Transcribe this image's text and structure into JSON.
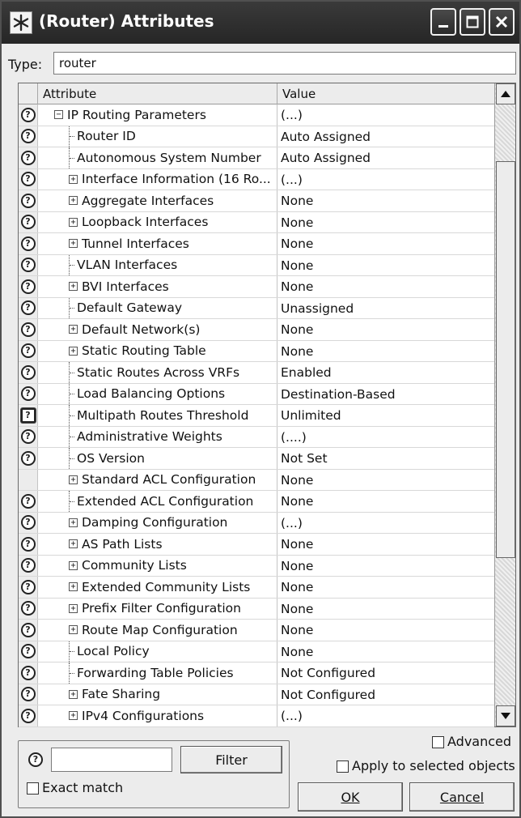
{
  "window": {
    "title": "(Router) Attributes",
    "icon": "asterisk-app-icon",
    "controls": [
      "minimize-icon",
      "maximize-icon",
      "close-icon"
    ]
  },
  "type_row": {
    "label": "Type:",
    "value": "router"
  },
  "table": {
    "headers": {
      "attribute": "Attribute",
      "value": "Value"
    },
    "rows": [
      {
        "attribute": "IP Routing Parameters",
        "value": "(...)",
        "node": "collapse",
        "level": 1,
        "icon": true
      },
      {
        "attribute": "Router ID",
        "value": "Auto Assigned",
        "node": "leaf",
        "level": 2,
        "icon": true
      },
      {
        "attribute": "Autonomous System Number",
        "value": "Auto Assigned",
        "node": "leaf",
        "level": 2,
        "icon": true
      },
      {
        "attribute": "Interface Information (16 Ro...",
        "value": "(...)",
        "node": "expand",
        "level": 2,
        "icon": true
      },
      {
        "attribute": "Aggregate Interfaces",
        "value": "None",
        "node": "expand",
        "level": 2,
        "icon": true
      },
      {
        "attribute": "Loopback Interfaces",
        "value": "None",
        "node": "expand",
        "level": 2,
        "icon": true
      },
      {
        "attribute": "Tunnel Interfaces",
        "value": "None",
        "node": "expand",
        "level": 2,
        "icon": true
      },
      {
        "attribute": "VLAN Interfaces",
        "value": "None",
        "node": "leaf",
        "level": 2,
        "icon": true
      },
      {
        "attribute": "BVI Interfaces",
        "value": "None",
        "node": "expand",
        "level": 2,
        "icon": true
      },
      {
        "attribute": "Default Gateway",
        "value": "Unassigned",
        "node": "leaf",
        "level": 2,
        "icon": true
      },
      {
        "attribute": "Default Network(s)",
        "value": "None",
        "node": "expand",
        "level": 2,
        "icon": true
      },
      {
        "attribute": "Static Routing Table",
        "value": "None",
        "node": "expand",
        "level": 2,
        "icon": true
      },
      {
        "attribute": "Static Routes Across VRFs",
        "value": "Enabled",
        "node": "leaf",
        "level": 2,
        "icon": true
      },
      {
        "attribute": "Load Balancing Options",
        "value": "Destination-Based",
        "node": "leaf",
        "level": 2,
        "icon": true
      },
      {
        "attribute": "Multipath Routes Threshold",
        "value": "Unlimited",
        "node": "leaf",
        "level": 2,
        "icon": true,
        "selected": true
      },
      {
        "attribute": "Administrative Weights",
        "value": "(....)",
        "node": "leaf",
        "level": 2,
        "icon": true
      },
      {
        "attribute": "OS Version",
        "value": "Not Set",
        "node": "leaf",
        "level": 2,
        "icon": true
      },
      {
        "attribute": "Standard ACL Configuration",
        "value": "None",
        "node": "expand",
        "level": 2,
        "icon": false
      },
      {
        "attribute": "Extended ACL Configuration",
        "value": "None",
        "node": "leaf",
        "level": 2,
        "icon": true
      },
      {
        "attribute": "Damping Configuration",
        "value": "(...)",
        "node": "expand",
        "level": 2,
        "icon": true
      },
      {
        "attribute": "AS Path Lists",
        "value": "None",
        "node": "expand",
        "level": 2,
        "icon": true
      },
      {
        "attribute": "Community Lists",
        "value": "None",
        "node": "expand",
        "level": 2,
        "icon": true
      },
      {
        "attribute": "Extended Community Lists",
        "value": "None",
        "node": "expand",
        "level": 2,
        "icon": true
      },
      {
        "attribute": "Prefix Filter Configuration",
        "value": "None",
        "node": "expand",
        "level": 2,
        "icon": true
      },
      {
        "attribute": "Route Map Configuration",
        "value": "None",
        "node": "expand",
        "level": 2,
        "icon": true
      },
      {
        "attribute": "Local Policy",
        "value": "None",
        "node": "leaf",
        "level": 2,
        "icon": true
      },
      {
        "attribute": "Forwarding Table Policies",
        "value": "Not Configured",
        "node": "leaf",
        "level": 2,
        "icon": true
      },
      {
        "attribute": "Fate Sharing",
        "value": "Not Configured",
        "node": "expand",
        "level": 2,
        "icon": true
      },
      {
        "attribute": "IPv4 Configurations",
        "value": "(...)",
        "node": "expand",
        "level": 2,
        "icon": true
      }
    ]
  },
  "filter": {
    "help_icon": "question-mark-icon",
    "input_value": "",
    "filter_button": "Filter",
    "exact_match": "Exact match",
    "exact_match_checked": false
  },
  "options": {
    "advanced": "Advanced",
    "advanced_checked": false,
    "apply_selected": "Apply to selected objects",
    "apply_selected_checked": false
  },
  "buttons": {
    "ok": "OK",
    "cancel": "Cancel"
  }
}
